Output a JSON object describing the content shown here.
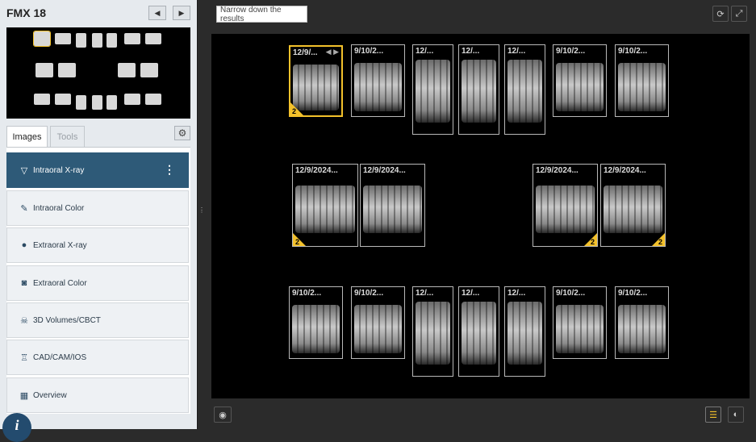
{
  "left": {
    "title": "FMX 18",
    "prev_icon": "◀",
    "next_icon": "▶",
    "tabs": [
      {
        "label": "Images"
      },
      {
        "label": "Tools"
      }
    ],
    "gear_icon": "⚙",
    "categories": [
      {
        "label": "Intraoral X-ray",
        "icon": "tooth-icon",
        "glyph": "🦷",
        "active": true
      },
      {
        "label": "Intraoral Color",
        "icon": "brush-icon",
        "glyph": "✎",
        "active": false
      },
      {
        "label": "Extraoral X-ray",
        "icon": "person-icon",
        "glyph": "●",
        "active": false
      },
      {
        "label": "Extraoral Color",
        "icon": "camera-icon",
        "glyph": "◙",
        "active": false
      },
      {
        "label": "3D Volumes/CBCT",
        "icon": "skull-icon",
        "glyph": "☠",
        "active": false
      },
      {
        "label": "CAD/CAM/IOS",
        "icon": "tooth-outline-icon",
        "glyph": "♖",
        "active": false
      },
      {
        "label": "Overview",
        "icon": "grid-icon",
        "glyph": "▦",
        "active": false
      }
    ],
    "more_icon": "⋮",
    "info_icon": "i"
  },
  "right": {
    "filter_placeholder": "Narrow down the results",
    "refresh_icon": "⟳",
    "expand_icon": "⤢",
    "eye_icon": "◉",
    "settings_icon": "☰",
    "contrast_icon": "◐",
    "splitter_icon": "⋮",
    "cards": [
      {
        "date": "12/9/...",
        "selected": true,
        "badge": "2",
        "badge_side": "left",
        "arrows": "◀ ▶"
      },
      {
        "date": "9/10/2..."
      },
      {
        "date": "12/..."
      },
      {
        "date": "12/..."
      },
      {
        "date": "12/..."
      },
      {
        "date": "9/10/2..."
      },
      {
        "date": "9/10/2..."
      },
      {
        "date": "12/9/2024...",
        "badge": "2",
        "badge_side": "left"
      },
      {
        "date": "12/9/2024..."
      },
      {
        "date": "12/9/2024...",
        "badge": "2",
        "badge_side": "right"
      },
      {
        "date": "12/9/2024...",
        "badge": "2",
        "badge_side": "right"
      },
      {
        "date": "9/10/2..."
      },
      {
        "date": "9/10/2..."
      },
      {
        "date": "12/..."
      },
      {
        "date": "12/..."
      },
      {
        "date": "12/..."
      },
      {
        "date": "9/10/2..."
      },
      {
        "date": "9/10/2..."
      }
    ]
  }
}
